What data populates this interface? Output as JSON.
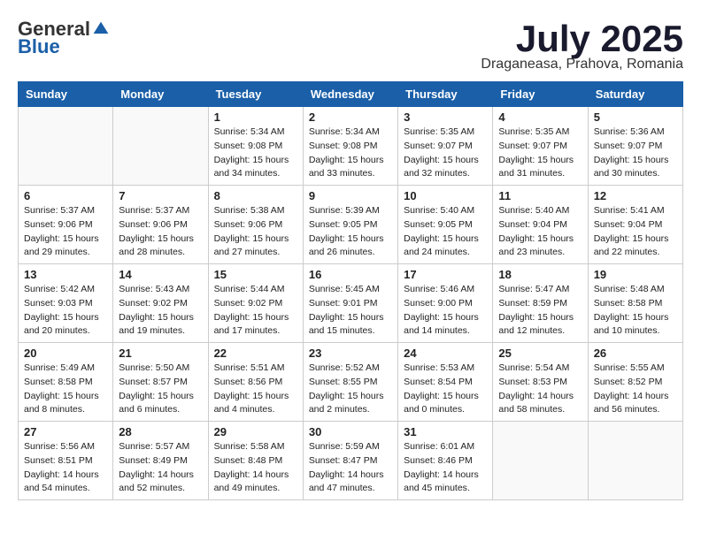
{
  "header": {
    "logo_general": "General",
    "logo_blue": "Blue",
    "month_title": "July 2025",
    "subtitle": "Draganeasa, Prahova, Romania"
  },
  "days_of_week": [
    "Sunday",
    "Monday",
    "Tuesday",
    "Wednesday",
    "Thursday",
    "Friday",
    "Saturday"
  ],
  "weeks": [
    [
      {
        "day": "",
        "info": ""
      },
      {
        "day": "",
        "info": ""
      },
      {
        "day": "1",
        "info": "Sunrise: 5:34 AM\nSunset: 9:08 PM\nDaylight: 15 hours and 34 minutes."
      },
      {
        "day": "2",
        "info": "Sunrise: 5:34 AM\nSunset: 9:08 PM\nDaylight: 15 hours and 33 minutes."
      },
      {
        "day": "3",
        "info": "Sunrise: 5:35 AM\nSunset: 9:07 PM\nDaylight: 15 hours and 32 minutes."
      },
      {
        "day": "4",
        "info": "Sunrise: 5:35 AM\nSunset: 9:07 PM\nDaylight: 15 hours and 31 minutes."
      },
      {
        "day": "5",
        "info": "Sunrise: 5:36 AM\nSunset: 9:07 PM\nDaylight: 15 hours and 30 minutes."
      }
    ],
    [
      {
        "day": "6",
        "info": "Sunrise: 5:37 AM\nSunset: 9:06 PM\nDaylight: 15 hours and 29 minutes."
      },
      {
        "day": "7",
        "info": "Sunrise: 5:37 AM\nSunset: 9:06 PM\nDaylight: 15 hours and 28 minutes."
      },
      {
        "day": "8",
        "info": "Sunrise: 5:38 AM\nSunset: 9:06 PM\nDaylight: 15 hours and 27 minutes."
      },
      {
        "day": "9",
        "info": "Sunrise: 5:39 AM\nSunset: 9:05 PM\nDaylight: 15 hours and 26 minutes."
      },
      {
        "day": "10",
        "info": "Sunrise: 5:40 AM\nSunset: 9:05 PM\nDaylight: 15 hours and 24 minutes."
      },
      {
        "day": "11",
        "info": "Sunrise: 5:40 AM\nSunset: 9:04 PM\nDaylight: 15 hours and 23 minutes."
      },
      {
        "day": "12",
        "info": "Sunrise: 5:41 AM\nSunset: 9:04 PM\nDaylight: 15 hours and 22 minutes."
      }
    ],
    [
      {
        "day": "13",
        "info": "Sunrise: 5:42 AM\nSunset: 9:03 PM\nDaylight: 15 hours and 20 minutes."
      },
      {
        "day": "14",
        "info": "Sunrise: 5:43 AM\nSunset: 9:02 PM\nDaylight: 15 hours and 19 minutes."
      },
      {
        "day": "15",
        "info": "Sunrise: 5:44 AM\nSunset: 9:02 PM\nDaylight: 15 hours and 17 minutes."
      },
      {
        "day": "16",
        "info": "Sunrise: 5:45 AM\nSunset: 9:01 PM\nDaylight: 15 hours and 15 minutes."
      },
      {
        "day": "17",
        "info": "Sunrise: 5:46 AM\nSunset: 9:00 PM\nDaylight: 15 hours and 14 minutes."
      },
      {
        "day": "18",
        "info": "Sunrise: 5:47 AM\nSunset: 8:59 PM\nDaylight: 15 hours and 12 minutes."
      },
      {
        "day": "19",
        "info": "Sunrise: 5:48 AM\nSunset: 8:58 PM\nDaylight: 15 hours and 10 minutes."
      }
    ],
    [
      {
        "day": "20",
        "info": "Sunrise: 5:49 AM\nSunset: 8:58 PM\nDaylight: 15 hours and 8 minutes."
      },
      {
        "day": "21",
        "info": "Sunrise: 5:50 AM\nSunset: 8:57 PM\nDaylight: 15 hours and 6 minutes."
      },
      {
        "day": "22",
        "info": "Sunrise: 5:51 AM\nSunset: 8:56 PM\nDaylight: 15 hours and 4 minutes."
      },
      {
        "day": "23",
        "info": "Sunrise: 5:52 AM\nSunset: 8:55 PM\nDaylight: 15 hours and 2 minutes."
      },
      {
        "day": "24",
        "info": "Sunrise: 5:53 AM\nSunset: 8:54 PM\nDaylight: 15 hours and 0 minutes."
      },
      {
        "day": "25",
        "info": "Sunrise: 5:54 AM\nSunset: 8:53 PM\nDaylight: 14 hours and 58 minutes."
      },
      {
        "day": "26",
        "info": "Sunrise: 5:55 AM\nSunset: 8:52 PM\nDaylight: 14 hours and 56 minutes."
      }
    ],
    [
      {
        "day": "27",
        "info": "Sunrise: 5:56 AM\nSunset: 8:51 PM\nDaylight: 14 hours and 54 minutes."
      },
      {
        "day": "28",
        "info": "Sunrise: 5:57 AM\nSunset: 8:49 PM\nDaylight: 14 hours and 52 minutes."
      },
      {
        "day": "29",
        "info": "Sunrise: 5:58 AM\nSunset: 8:48 PM\nDaylight: 14 hours and 49 minutes."
      },
      {
        "day": "30",
        "info": "Sunrise: 5:59 AM\nSunset: 8:47 PM\nDaylight: 14 hours and 47 minutes."
      },
      {
        "day": "31",
        "info": "Sunrise: 6:01 AM\nSunset: 8:46 PM\nDaylight: 14 hours and 45 minutes."
      },
      {
        "day": "",
        "info": ""
      },
      {
        "day": "",
        "info": ""
      }
    ]
  ]
}
